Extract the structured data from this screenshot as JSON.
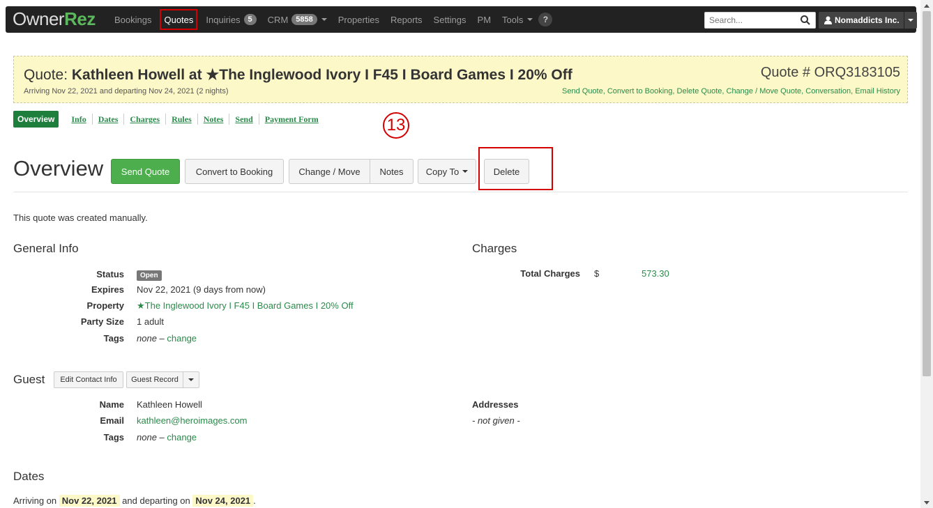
{
  "brand": {
    "owner": "Owner",
    "rez": "Rez"
  },
  "nav": {
    "bookings": "Bookings",
    "quotes": "Quotes",
    "inquiries": "Inquiries",
    "inquiries_count": "5",
    "crm": "CRM",
    "crm_count": "5858",
    "properties": "Properties",
    "reports": "Reports",
    "settings": "Settings",
    "pm": "PM",
    "tools": "Tools",
    "help": "?"
  },
  "search": {
    "placeholder": "Search..."
  },
  "user": {
    "name": "Nomaddicts Inc."
  },
  "quote": {
    "label": "Quote:",
    "title": "Kathleen Howell at ★The Inglewood Ivory I F45 I Board Games I 20% Off",
    "subtitle": "Arriving Nov 22, 2021 and departing Nov 24, 2021 (2 nights)",
    "number": "Quote # ORQ3183105",
    "actions": [
      "Send Quote",
      "Convert to Booking",
      "Delete Quote",
      "Change / Move Quote",
      "Conversation",
      "Email History"
    ]
  },
  "tabs": [
    "Overview",
    "Info",
    "Dates",
    "Charges",
    "Rules",
    "Notes",
    "Send",
    "Payment Form"
  ],
  "annotation": "13",
  "overview": {
    "title": "Overview",
    "send_quote": "Send Quote",
    "convert": "Convert to Booking",
    "change_move": "Change / Move",
    "notes": "Notes",
    "copy_to": "Copy To",
    "delete": "Delete",
    "created_note": "This quote was created manually."
  },
  "general": {
    "heading": "General Info",
    "status_label": "Status",
    "status": "Open",
    "expires_label": "Expires",
    "expires": "Nov 22, 2021 (9 days from now)",
    "property_label": "Property",
    "property": "★The Inglewood Ivory I F45 I Board Games I 20% Off",
    "party_label": "Party Size",
    "party": "1 adult",
    "tags_label": "Tags",
    "tags_none": "none",
    "tags_change": "change"
  },
  "charges": {
    "heading": "Charges",
    "total_label": "Total Charges",
    "currency": "$",
    "total": "573.30"
  },
  "guest": {
    "heading": "Guest",
    "edit_contact": "Edit Contact Info",
    "guest_record": "Guest Record",
    "name_label": "Name",
    "name": "Kathleen Howell",
    "email_label": "Email",
    "email": "kathleen@heroimages.com",
    "tags_label": "Tags",
    "tags_none": "none",
    "tags_change": "change",
    "addresses_label": "Addresses",
    "addresses": "- not given -"
  },
  "dates": {
    "heading": "Dates",
    "arriving_on": "Arriving on",
    "arrive": "Nov 22, 2021",
    "and_departing": "and departing on",
    "depart": "Nov 24, 2021",
    "period": "."
  },
  "colors": {
    "brand_green": "#5cb85c",
    "link_green": "#2a8a4a",
    "highlight_red": "#d40000",
    "header_yellow": "#fcf8c8"
  }
}
